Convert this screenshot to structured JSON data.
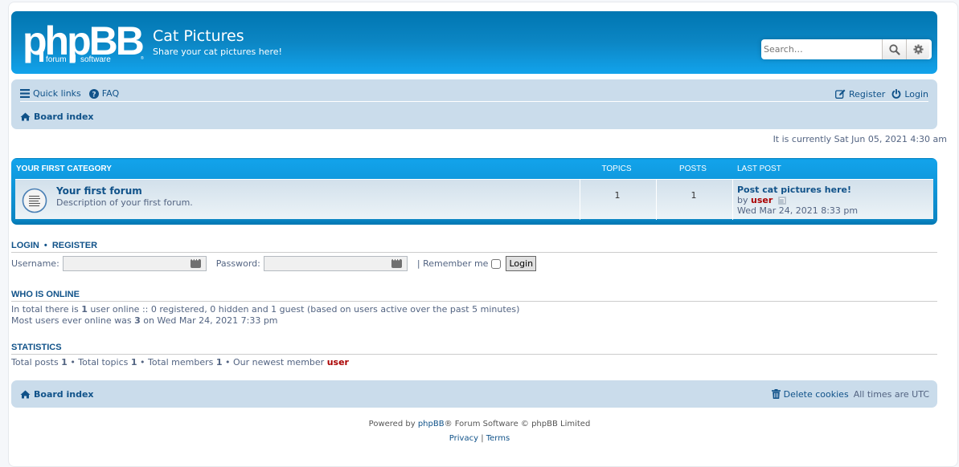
{
  "header": {
    "logo_text": "phpBB",
    "logo_sub1": "forum",
    "logo_sub2": "software",
    "site_title": "Cat Pictures",
    "site_description": "Share your cat pictures here!",
    "search": {
      "placeholder": "Search…",
      "value": "",
      "search_icon": "search-icon",
      "advanced_icon": "gear-icon"
    }
  },
  "navbar": {
    "quick_links": "Quick links",
    "faq": "FAQ",
    "register": "Register",
    "login": "Login",
    "breadcrumb": "Board index"
  },
  "current_time": "It is currently Sat Jun 05, 2021 4:30 am",
  "forum_list": {
    "category": "YOUR FIRST CATEGORY",
    "columns": {
      "topics": "TOPICS",
      "posts": "POSTS",
      "last_post": "LAST POST"
    },
    "forums": [
      {
        "title": "Your first forum",
        "description": "Description of your first forum.",
        "topics": "1",
        "posts": "1",
        "last_post": {
          "title": "Post cat pictures here!",
          "by": "by",
          "author": "user",
          "date": "Wed Mar 24, 2021 8:33 pm"
        }
      }
    ]
  },
  "login_section": {
    "title_login": "LOGIN",
    "separator": "•",
    "title_register": "REGISTER",
    "username_label": "Username:",
    "username_value": "",
    "password_label": "Password:",
    "password_value": "",
    "remember_label": "| Remember me",
    "remember_checked": false,
    "login_button": "Login"
  },
  "who_is_online": {
    "title": "WHO IS ONLINE",
    "line1_pre": "In total there is ",
    "line1_count": "1",
    "line1_post": " user online :: 0 registered, 0 hidden and 1 guest (based on users active over the past 5 minutes)",
    "line2_pre": "Most users ever online was ",
    "line2_count": "3",
    "line2_post": " on Wed Mar 24, 2021 7:33 pm"
  },
  "statistics": {
    "title": "STATISTICS",
    "posts_label": "Total posts ",
    "posts": "1",
    "topics_label": " • Total topics ",
    "topics": "1",
    "members_label": " • Total members ",
    "members": "1",
    "newest_label": " • Our newest member ",
    "newest": "user"
  },
  "footer_nav": {
    "breadcrumb": "Board index",
    "delete_cookies": "Delete cookies",
    "timezone": "All times are UTC"
  },
  "copyright": {
    "powered_pre": "Powered by ",
    "phpbb_link": "phpBB",
    "powered_post": "® Forum Software © phpBB Limited",
    "privacy": "Privacy",
    "sep": " | ",
    "terms": "Terms"
  },
  "colors": {
    "header_blue": "#0c86c4",
    "nav_bg": "#cadceb",
    "link": "#105289",
    "username": "#aa0000",
    "text": "#536482"
  }
}
